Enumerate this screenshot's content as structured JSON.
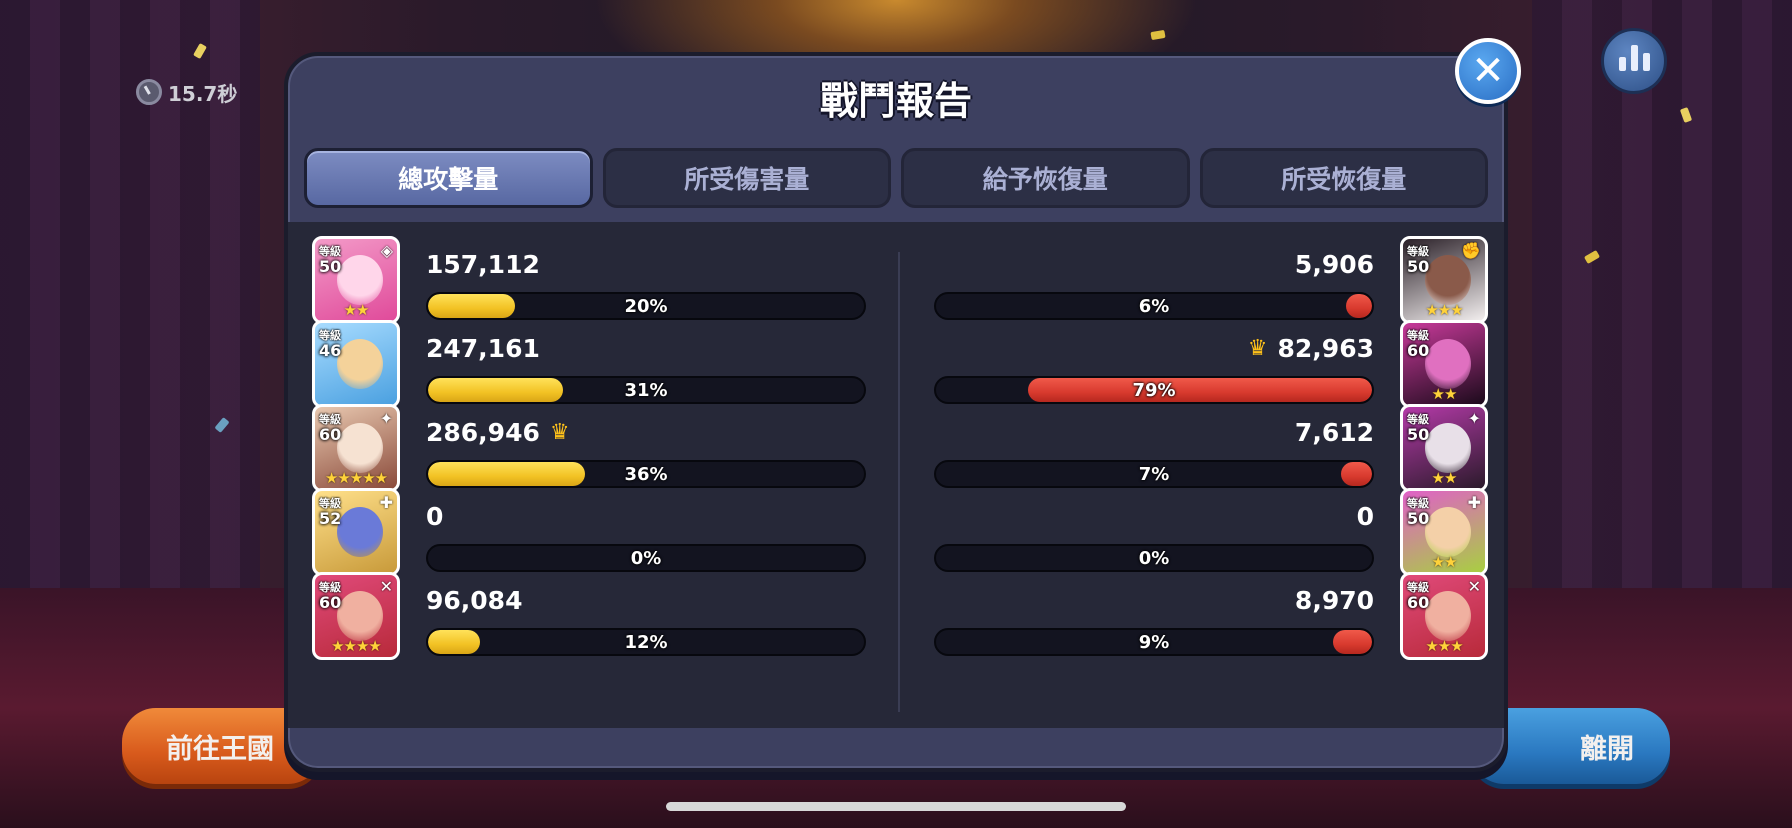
{
  "hud": {
    "timer": "15.7秒",
    "clock_icon": "clock-icon",
    "stats_icon": "bar-chart-icon"
  },
  "panel": {
    "title": "戰鬥報告",
    "close_icon": "close-icon",
    "tabs": [
      {
        "label": "總攻擊量",
        "active": true
      },
      {
        "label": "所受傷害量",
        "active": false
      },
      {
        "label": "給予恢復量",
        "active": false
      },
      {
        "label": "所受恢復量",
        "active": false
      }
    ],
    "level_label": "等級",
    "left_team": [
      {
        "level": "50",
        "stars": "★★",
        "badge": "◈",
        "value": "157,112",
        "percent": "20%",
        "fraction": 0.2,
        "crown": false,
        "colors": [
          "#f39ac8",
          "#e04a9a",
          "#ffd6ea"
        ]
      },
      {
        "level": "46",
        "stars": "",
        "badge": "",
        "value": "247,161",
        "percent": "31%",
        "fraction": 0.31,
        "crown": false,
        "colors": [
          "#a8dcff",
          "#4aa0e0",
          "#f4d29a"
        ]
      },
      {
        "level": "60",
        "stars": "★★★★★",
        "badge": "✦",
        "value": "286,946",
        "percent": "36%",
        "fraction": 0.36,
        "crown": true,
        "colors": [
          "#e8c8b0",
          "#8a4a3a",
          "#f6e2d2"
        ]
      },
      {
        "level": "52",
        "stars": "",
        "badge": "✚",
        "value": "0",
        "percent": "0%",
        "fraction": 0.0,
        "crown": false,
        "colors": [
          "#ffe08a",
          "#c89a3a",
          "#6a7ad8"
        ]
      },
      {
        "level": "60",
        "stars": "★★★★",
        "badge": "✕",
        "value": "96,084",
        "percent": "12%",
        "fraction": 0.12,
        "crown": false,
        "colors": [
          "#e04a7a",
          "#b82a3a",
          "#f0b0a0"
        ]
      }
    ],
    "right_team": [
      {
        "level": "50",
        "stars": "★★★",
        "badge": "✊",
        "value": "5,906",
        "percent": "6%",
        "fraction": 0.06,
        "crown": false,
        "colors": [
          "#2a2028",
          "#f4f0f0",
          "#8a5a4a"
        ]
      },
      {
        "level": "60",
        "stars": "★★",
        "badge": "",
        "value": "82,963",
        "percent": "79%",
        "fraction": 0.79,
        "crown": true,
        "colors": [
          "#c83a9a",
          "#1a0a1a",
          "#e070c0"
        ]
      },
      {
        "level": "50",
        "stars": "★★",
        "badge": "✦",
        "value": "7,612",
        "percent": "7%",
        "fraction": 0.07,
        "crown": false,
        "colors": [
          "#b43aa8",
          "#2a1a2a",
          "#e8e0e8"
        ]
      },
      {
        "level": "50",
        "stars": "★★",
        "badge": "✚",
        "value": "0",
        "percent": "0%",
        "fraction": 0.0,
        "crown": false,
        "colors": [
          "#e060c8",
          "#a8d040",
          "#f4d0a8"
        ]
      },
      {
        "level": "60",
        "stars": "★★★",
        "badge": "✕",
        "value": "8,970",
        "percent": "9%",
        "fraction": 0.09,
        "crown": false,
        "colors": [
          "#e04a7a",
          "#b82a3a",
          "#f0b0a0"
        ]
      }
    ]
  },
  "buttons": {
    "kingdom": "前往王國",
    "exit": "離開"
  },
  "crown_icon": "crown-icon",
  "accent_colors": {
    "attack_bar": "#f2c224",
    "damage_bar": "#d83a2e",
    "active_tab": "#6a7ab4"
  }
}
